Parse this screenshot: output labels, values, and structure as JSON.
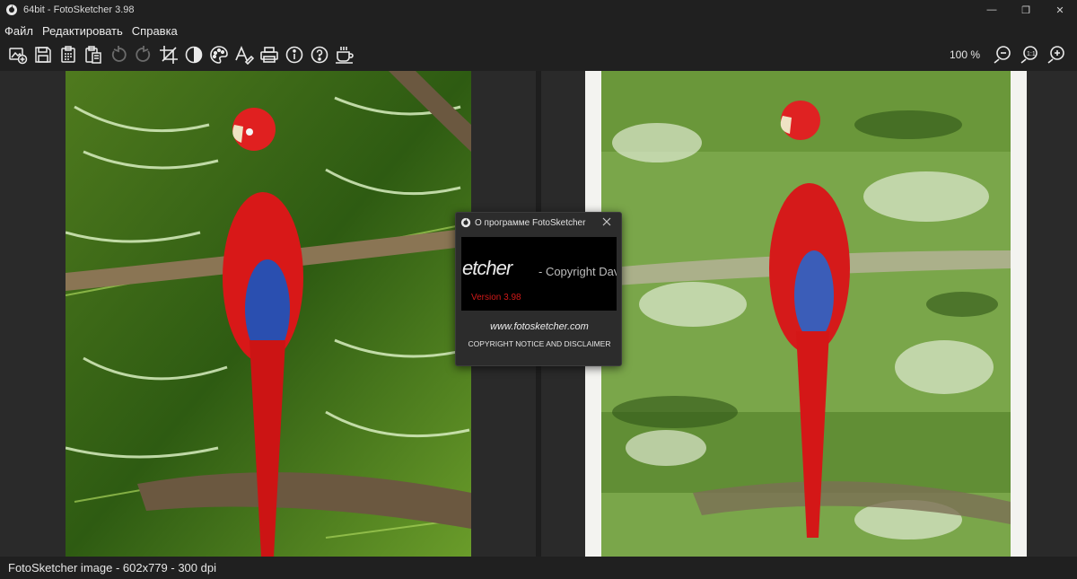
{
  "window": {
    "title": "64bit - FotoSketcher 3.98",
    "controls": {
      "minimize": "—",
      "restore": "❐",
      "close": "✕"
    }
  },
  "menu": {
    "items": [
      "Файл",
      "Редактировать",
      "Справка"
    ]
  },
  "toolbar": {
    "tools": [
      "open-image-icon",
      "save-icon",
      "copy-icon",
      "paste-icon",
      "undo-icon",
      "redo-icon",
      "crop-icon",
      "contrast-icon",
      "palette-icon",
      "text-icon",
      "print-icon",
      "info-icon",
      "help-icon",
      "coffee-icon"
    ],
    "zoom_level": "100 %",
    "zoom_tools": [
      "zoom-out-icon",
      "zoom-actual-icon",
      "zoom-in-icon"
    ]
  },
  "status": {
    "text": "FotoSketcher image - 602x779 - 300 dpi"
  },
  "about_dialog": {
    "title": "О программе FotoSketcher",
    "banner_brand": "etcher",
    "banner_copyright": "- Copyright David T",
    "banner_version": "Version 3.98",
    "url": "www.fotosketcher.com",
    "notice": "COPYRIGHT NOTICE AND DISCLAIMER"
  },
  "colors": {
    "background": "#202020",
    "workspace": "#2a2a2a",
    "version_red": "#d21919"
  }
}
